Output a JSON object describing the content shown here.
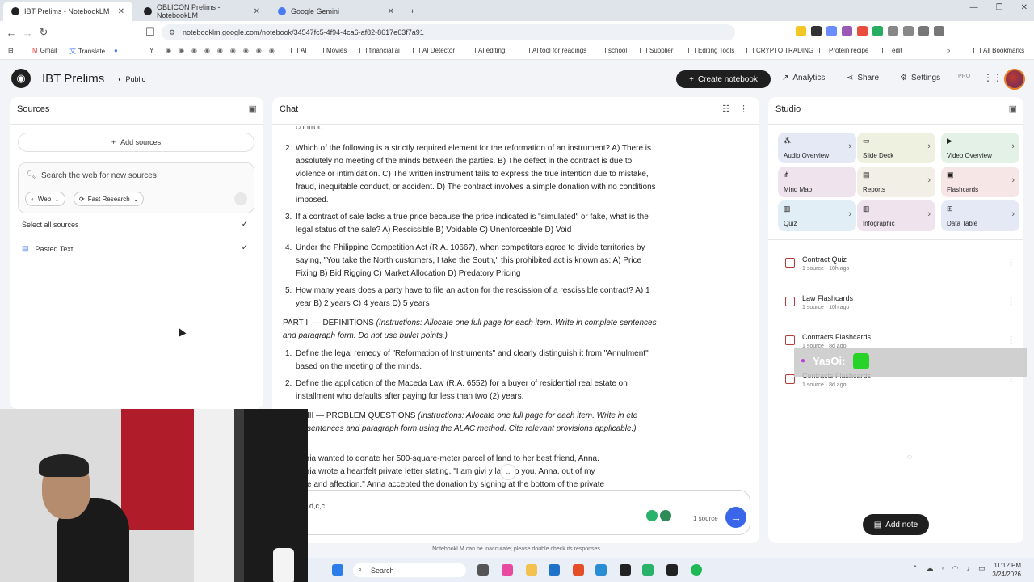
{
  "browser": {
    "tabs": [
      {
        "title": "IBT Prelims - NotebookLM",
        "active": true
      },
      {
        "title": "OBLICON Prelims - NotebookLM",
        "active": false
      },
      {
        "title": "Google Gemini",
        "active": false
      }
    ],
    "new_tab": "+",
    "url": "notebooklm.google.com/notebook/34547fc5-4f94-4ca6-af82-8617e63f7a91",
    "bookmarks": [
      "Gmail",
      "Translate",
      "Y",
      "AI",
      "Movies",
      "financial ai",
      "AI Detector",
      "AI editing",
      "AI tool for readings",
      "school",
      "Supplier",
      "Editing Tools",
      "CRYPTO TRADING",
      "Protein recipe",
      "edit",
      "All Bookmarks"
    ]
  },
  "header": {
    "title": "IBT Prelims",
    "public_label": "Public",
    "create_label": "Create notebook",
    "analytics_label": "Analytics",
    "share_label": "Share",
    "settings_label": "Settings",
    "pro_label": "PRO"
  },
  "sources": {
    "title": "Sources",
    "add_label": "Add sources",
    "search_placeholder": "Search the web for new sources",
    "web_label": "Web",
    "research_label": "Fast Research",
    "select_all": "Select all sources",
    "items": [
      {
        "name": "Pasted Text",
        "checked": true
      }
    ]
  },
  "chat": {
    "title": "Chat",
    "top_fragment": "control.",
    "items": [
      {
        "n": "2.",
        "text": "Which of the following is a strictly required element for the reformation of an instrument? A) There is absolutely no meeting of the minds between the parties. B) The defect in the contract is due to violence or intimidation. C) The written instrument fails to express the true intention due to mistake, fraud, inequitable conduct, or accident. D) The contract involves a simple donation with no conditions imposed."
      },
      {
        "n": "3.",
        "text": "If a contract of sale lacks a true price because the price indicated is \"simulated\" or fake, what is the legal status of the sale? A) Rescissible B) Voidable C) Unenforceable D) Void"
      },
      {
        "n": "4.",
        "text": "Under the Philippine Competition Act (R.A. 10667), when competitors agree to divide territories by saying, \"You take the North customers, I take the South,\" this prohibited act is known as: A) Price Fixing B) Bid Rigging C) Market Allocation D) Predatory Pricing"
      },
      {
        "n": "5.",
        "text": "How many years does a party have to file an action for the rescission of a rescissible contract? A) 1 year B) 2 years C) 4 years D) 5 years"
      }
    ],
    "part2_heading": "PART II — DEFINITIONS",
    "part2_instr": "(Instructions: Allocate one full page for each item. Write in complete sentences and paragraph form. Do not use bullet points.)",
    "part2_items": [
      {
        "n": "1.",
        "text": "Define the legal remedy of \"Reformation of Instruments\" and clearly distinguish it from \"Annulment\" based on the meeting of the minds."
      },
      {
        "n": "2.",
        "text": "Define the application of the Maceda Law (R.A. 6552) for a buyer of residential real estate on installment who defaults after paying for less than two (2) years."
      }
    ],
    "part3_heading": "III — PROBLEM QUESTIONS",
    "part3_instr": "(Instructions: Allocate one full page for each item. Write in ete sentences and paragraph form using the ALAC method. Cite relevant provisions applicable.)",
    "part3_lines": [
      "ria wanted to donate her 500-square-meter parcel of land to her best friend, Anna.",
      "ria wrote a heartfelt private letter stating, \"I am givi    y land to you, Anna, out of my",
      "e and affection.\" Anna accepted the donation by signing at the bottom of the private"
    ],
    "input_value": "d,c,c",
    "source_count": "1 source",
    "disclaimer": "NotebookLM can be inaccurate; please double check its responses."
  },
  "studio": {
    "title": "Studio",
    "tiles": [
      {
        "label": "Audio Overview",
        "color": "#e5e9f6",
        "icon": "audio-icon"
      },
      {
        "label": "Slide Deck",
        "color": "#eef0e0",
        "icon": "slides-icon"
      },
      {
        "label": "Video Overview",
        "color": "#e3f1e6",
        "icon": "video-icon"
      },
      {
        "label": "Mind Map",
        "color": "#efe3ee",
        "icon": "mindmap-icon"
      },
      {
        "label": "Reports",
        "color": "#f1efe6",
        "icon": "reports-icon"
      },
      {
        "label": "Flashcards",
        "color": "#f6e6e6",
        "icon": "flashcards-icon"
      },
      {
        "label": "Quiz",
        "color": "#e2eef6",
        "icon": "quiz-icon"
      },
      {
        "label": "Infographic",
        "color": "#efe3ee",
        "icon": "infographic-icon"
      },
      {
        "label": "Data Table",
        "color": "#e5e9f6",
        "icon": "table-icon"
      }
    ],
    "notes": [
      {
        "title": "Contract Quiz",
        "sub": "1 source · 10h ago"
      },
      {
        "title": "Law Flashcards",
        "sub": "1 source · 10h ago"
      },
      {
        "title": "Contracts Flashcards",
        "sub": "1 source · 8d ago"
      },
      {
        "title": "Contracts Flashcards",
        "sub": "1 source · 8d ago"
      }
    ],
    "add_note_label": "Add note"
  },
  "overlay": {
    "name": "YasOi:"
  },
  "taskbar": {
    "search_label": "Search",
    "time": "11:12 PM",
    "date": "3/24/2026"
  }
}
